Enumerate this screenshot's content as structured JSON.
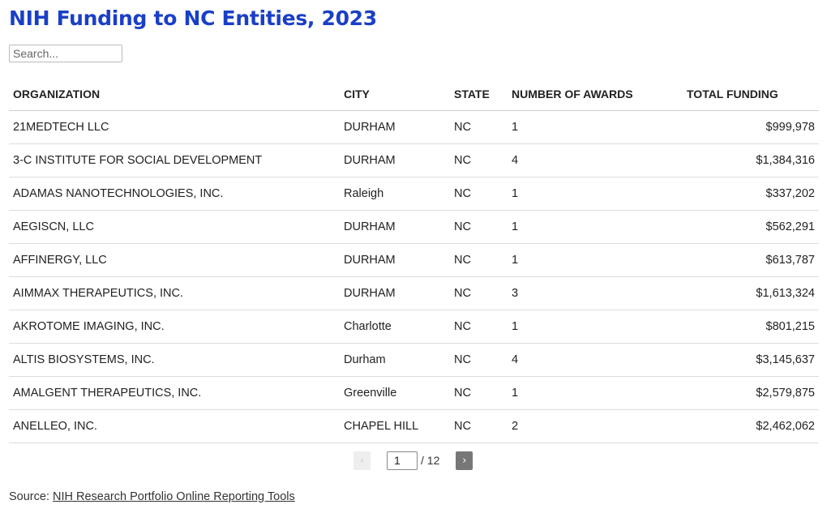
{
  "title": "NIH Funding to NC Entities, 2023",
  "search": {
    "placeholder": "Search..."
  },
  "table": {
    "headers": [
      "ORGANIZATION",
      "CITY",
      "STATE",
      "NUMBER OF AWARDS",
      "TOTAL FUNDING"
    ],
    "rows": [
      [
        "21MEDTECH LLC",
        "DURHAM",
        "NC",
        "1",
        "$999,978"
      ],
      [
        "3-C INSTITUTE FOR SOCIAL DEVELOPMENT",
        "DURHAM",
        "NC",
        "4",
        "$1,384,316"
      ],
      [
        "ADAMAS NANOTECHNOLOGIES, INC.",
        "Raleigh",
        "NC",
        "1",
        "$337,202"
      ],
      [
        "AEGISCN, LLC",
        "DURHAM",
        "NC",
        "1",
        "$562,291"
      ],
      [
        "AFFINERGY, LLC",
        "DURHAM",
        "NC",
        "1",
        "$613,787"
      ],
      [
        "AIMMAX THERAPEUTICS, INC.",
        "DURHAM",
        "NC",
        "3",
        "$1,613,324"
      ],
      [
        "AKROTOME IMAGING, INC.",
        "Charlotte",
        "NC",
        "1",
        "$801,215"
      ],
      [
        "ALTIS BIOSYSTEMS, INC.",
        "Durham",
        "NC",
        "4",
        "$3,145,637"
      ],
      [
        "AMALGENT THERAPEUTICS, INC.",
        "Greenville",
        "NC",
        "1",
        "$2,579,875"
      ],
      [
        "ANELLEO, INC.",
        "CHAPEL HILL",
        "NC",
        "2",
        "$2,462,062"
      ]
    ]
  },
  "pagination": {
    "prev_label": "‹",
    "next_label": "›",
    "current_page": "1",
    "total_label": "/ 12"
  },
  "source": {
    "prefix": "Source: ",
    "link_text": "NIH Research Portfolio Online Reporting Tools"
  }
}
